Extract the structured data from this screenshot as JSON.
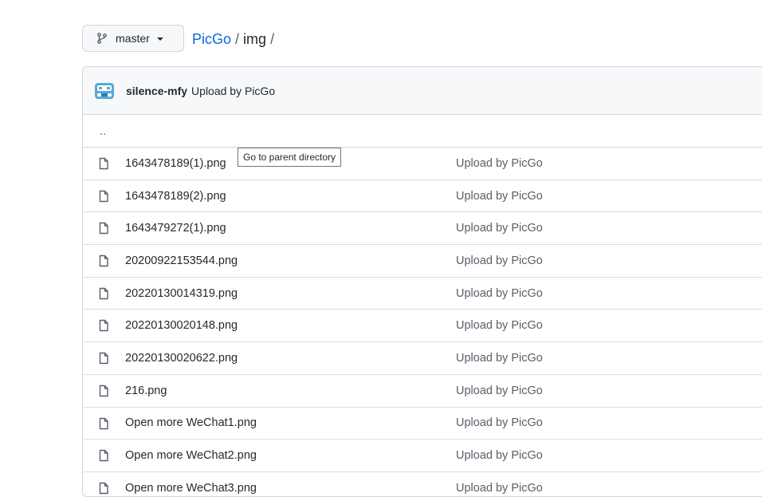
{
  "branch": {
    "name": "master"
  },
  "breadcrumb": {
    "repo": "PicGo",
    "sep1": "/",
    "folder": "img",
    "sep2": "/"
  },
  "commit": {
    "author": "silence-mfy",
    "message": "Upload by PicGo"
  },
  "parent": {
    "label": "..",
    "tooltip": "Go to parent directory"
  },
  "files": [
    {
      "name": "1643478189(1).png",
      "commit": "Upload by PicGo"
    },
    {
      "name": "1643478189(2).png",
      "commit": "Upload by PicGo"
    },
    {
      "name": "1643479272(1).png",
      "commit": "Upload by PicGo"
    },
    {
      "name": "20200922153544.png",
      "commit": "Upload by PicGo"
    },
    {
      "name": "20220130014319.png",
      "commit": "Upload by PicGo"
    },
    {
      "name": "20220130020148.png",
      "commit": "Upload by PicGo"
    },
    {
      "name": "20220130020622.png",
      "commit": "Upload by PicGo"
    },
    {
      "name": "216.png",
      "commit": "Upload by PicGo"
    },
    {
      "name": "Open more WeChat1.png",
      "commit": "Upload by PicGo"
    },
    {
      "name": "Open more WeChat2.png",
      "commit": "Upload by PicGo"
    },
    {
      "name": "Open more WeChat3.png",
      "commit": "Upload by PicGo"
    }
  ]
}
